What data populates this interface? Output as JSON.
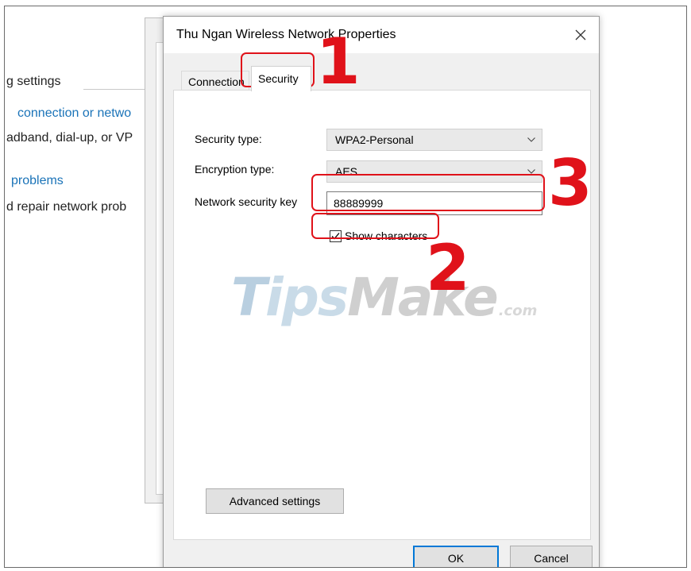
{
  "background": {
    "heading": "g settings",
    "link1": "connection or netwo",
    "text1": "adband, dial-up, or VP",
    "link2": "problems",
    "text2": "d repair network prob",
    "link_color": "#1a73b8"
  },
  "dialog": {
    "title": "Thu Ngan Wireless Network Properties",
    "close_icon": "close-icon",
    "tabs": [
      {
        "label": "Connection",
        "selected": false
      },
      {
        "label": "Security",
        "selected": true
      }
    ],
    "security_type": {
      "label": "Security type:",
      "value": "WPA2-Personal"
    },
    "encryption_type": {
      "label": "Encryption type:",
      "value": "AES"
    },
    "network_key": {
      "label": "Network security key",
      "value": "88889999"
    },
    "show_characters": {
      "label": "Show characters",
      "checked": true
    },
    "advanced_button": "Advanced settings",
    "ok_button": "OK",
    "cancel_button": "Cancel"
  },
  "annotations": {
    "num1": "1",
    "num2": "2",
    "num3": "3",
    "color": "#e0121a"
  },
  "watermark": {
    "t": "T",
    "ips": "ips",
    "make": "Make",
    "com": ".com"
  }
}
